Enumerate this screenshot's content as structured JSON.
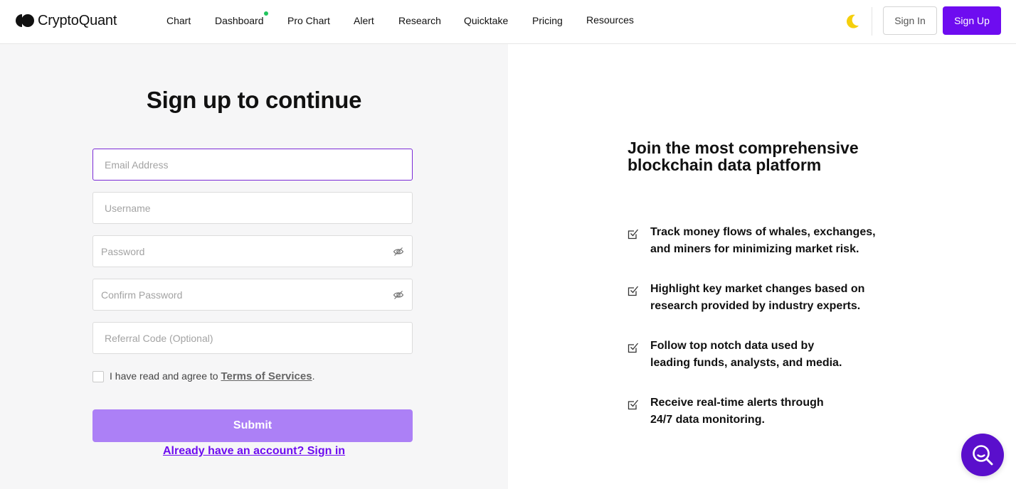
{
  "brand": {
    "name": "CryptoQuant",
    "accent": "#6e0cf0"
  },
  "nav": {
    "items": [
      {
        "label": "Chart"
      },
      {
        "label": "Dashboard",
        "has_dot": true
      },
      {
        "label": "Pro Chart"
      },
      {
        "label": "Alert"
      },
      {
        "label": "Research"
      },
      {
        "label": "Quicktake"
      },
      {
        "label": "Pricing"
      },
      {
        "label": "Resources"
      }
    ],
    "theme_icon": "moon-icon",
    "sign_in_label": "Sign In",
    "sign_up_label": "Sign Up"
  },
  "form": {
    "title": "Sign up to continue",
    "email_placeholder": "Email Address",
    "username_placeholder": "Username",
    "password_placeholder": "Password",
    "confirm_password_placeholder": "Confirm Password",
    "referral_placeholder": "Referral Code (Optional)",
    "agree_text": "I have read and agree to",
    "terms_label": "Terms of Services",
    "agree_suffix": ".",
    "submit_label": "Submit",
    "signin_link": "Already have an account? Sign in"
  },
  "promo": {
    "title_line1": "Join the most comprehensive",
    "title_line2": "blockchain data platform",
    "features": [
      {
        "line1": "Track money flows of whales, exchanges,",
        "line2": "and miners for minimizing market risk."
      },
      {
        "line1": "Highlight key market changes based on",
        "line2": "research provided by industry experts."
      },
      {
        "line1": "Follow top notch data used by",
        "line2": "leading funds, analysts, and media."
      },
      {
        "line1": "Receive real-time alerts through",
        "line2": "24/7 data monitoring."
      }
    ]
  },
  "chat_icon": "chat-search-icon"
}
